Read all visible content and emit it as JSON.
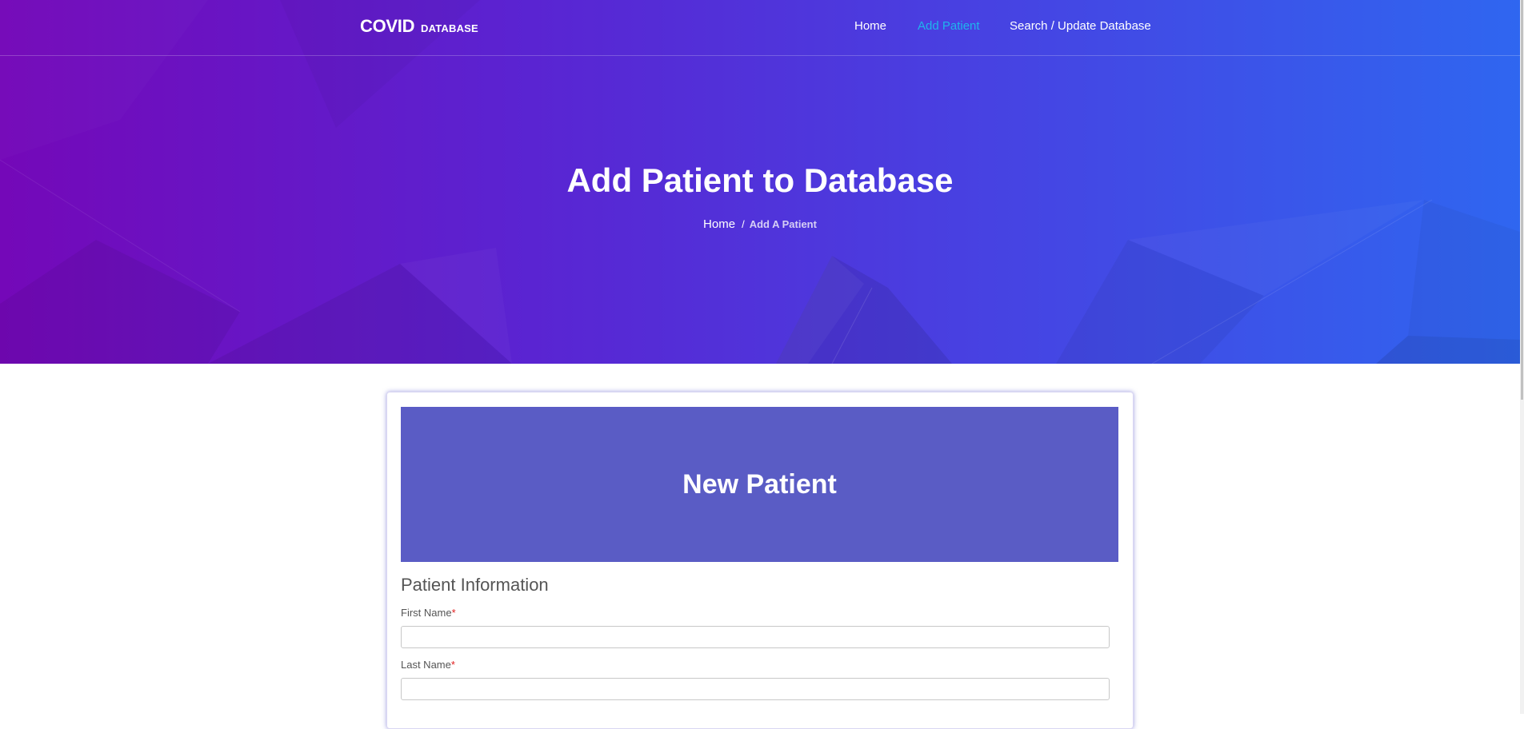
{
  "brand": {
    "main": "COVID",
    "sub": "DATABASE"
  },
  "nav": {
    "items": [
      {
        "label": "Home"
      },
      {
        "label": "Add Patient",
        "active": true
      },
      {
        "label": "Search / Update Database"
      }
    ]
  },
  "hero": {
    "title": "Add Patient to Database",
    "breadcrumb": {
      "home": "Home",
      "separator": "/",
      "current": "Add A Patient"
    }
  },
  "form": {
    "header": "New Patient",
    "section_title": "Patient Information",
    "fields": [
      {
        "label": "First Name",
        "required_mark": "*",
        "value": "",
        "placeholder": ""
      },
      {
        "label": "Last Name",
        "required_mark": "*",
        "value": "",
        "placeholder": ""
      }
    ]
  },
  "colors": {
    "gradient_start": "#7408b8",
    "gradient_end": "#2f66f0",
    "nav_active": "#1fb5ec",
    "card_header": "#5a5cc5",
    "required": "#e02020"
  }
}
